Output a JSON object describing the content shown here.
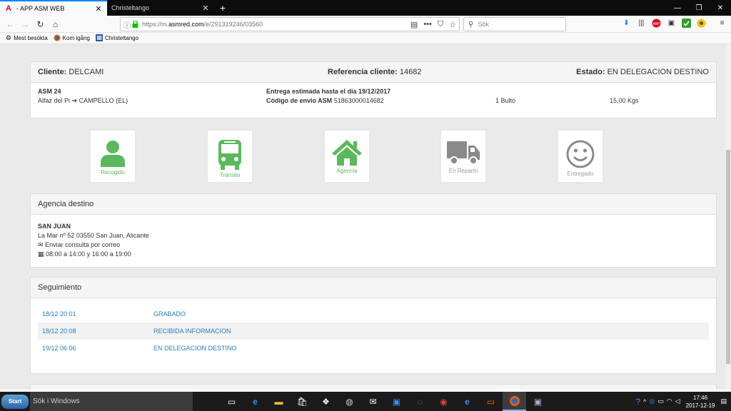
{
  "browser": {
    "tabs": [
      {
        "title": "- APP ASM WEB",
        "active": true
      },
      {
        "title": "Christeltango",
        "active": false
      }
    ],
    "url_prefix": "https://m.",
    "url_domain": "asmred.com",
    "url_path": "/e/291319246/03560",
    "search_placeholder": "Sök",
    "bookmarks": [
      {
        "label": "Mest besökta",
        "icon": "gear-icon"
      },
      {
        "label": "Kom igång",
        "icon": "firefox-icon"
      },
      {
        "label": "Christeltango",
        "icon": "site-icon"
      }
    ]
  },
  "summary": {
    "cliente_label": "Cliente:",
    "cliente_value": "DELCAMI",
    "referencia_label": "Referencia cliente:",
    "referencia_value": "14682",
    "estado_label": "Estado:",
    "estado_value": "EN DELEGACION DESTINO",
    "origin_name": "ASM 24",
    "route_from": "Alfaz del Pi",
    "route_to": "CAMPELLO (EL)",
    "entrega_label": "Entrega estimada hasta el dia 19/12/2017",
    "codigo_label": "Código de envio ASM",
    "codigo_value": "51863000014682",
    "bultos": "1 Bulto",
    "peso": "15,00 Kgs"
  },
  "steps": [
    {
      "label": "Recogido",
      "icon": "person-icon",
      "done": true
    },
    {
      "label": "Tránsito",
      "icon": "bus-icon",
      "done": true
    },
    {
      "label": "Agencia",
      "icon": "home-icon",
      "done": true
    },
    {
      "label": "En Reparto",
      "icon": "truck-icon",
      "done": false
    },
    {
      "label": "Entregado",
      "icon": "smiley-icon",
      "done": false
    }
  ],
  "agency": {
    "heading": "Agencia destino",
    "name": "SAN JUAN",
    "address": "La Mar nº 52 03550 San Juan, Alicante",
    "email_link": "Enviar consulta por correo",
    "hours": "08:00 a 14:00 y 16:00 a 19:00"
  },
  "tracking": {
    "heading": "Seguimiento",
    "rows": [
      {
        "date": "18/12 20:01",
        "status": "GRABADO"
      },
      {
        "date": "18/12 20:08",
        "status": "RECIBIDA INFORMACION"
      },
      {
        "date": "19/12 06:06",
        "status": "EN DELEGACION DESTINO"
      }
    ]
  },
  "taskbar": {
    "start_label": "Start",
    "search_placeholder": "Sök i Windows",
    "time": "17:46",
    "date": "2017-12-19"
  },
  "colors": {
    "done": "#5cb85c",
    "pending": "#8a8a8a",
    "link": "#2a7db5"
  }
}
